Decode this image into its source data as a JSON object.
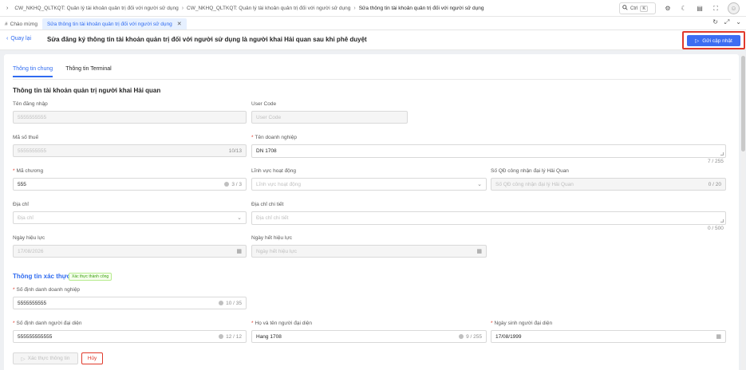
{
  "breadcrumb": [
    "CW_NKHQ_QLTKQT: Quản lý tài khoản quản trị đối với người sử dụng",
    "CW_NKHQ_QLTKQT: Quản lý tài khoản quản trị đối với người sử dụng",
    "Sửa thông tin tài khoản quản trị đối với người sử dụng"
  ],
  "search": {
    "kbd1": "Ctrl",
    "kbd2": "K"
  },
  "tabs": [
    {
      "label": "Chào mừng"
    },
    {
      "label": "Sửa thông tin tài khoản quản trị đối với người sử dụng"
    }
  ],
  "header": {
    "back_label": "Quay lại",
    "title": "Sửa đăng ký thông tin tài khoản quản trị đối với người sử dụng là người khai Hải quan sau khi phê duyệt",
    "submit_label": "Gửi cập nhật"
  },
  "form_tabs": [
    "Thông tin chung",
    "Thông tin Terminal"
  ],
  "section1": {
    "title": "Thông tin tài khoản quản trị người khai Hải quan",
    "username": {
      "label": "Tên đăng nhập",
      "value": "5555555555"
    },
    "user_code": {
      "label": "User Code",
      "placeholder": "User Code"
    },
    "tax_code": {
      "label": "Mã số thuế",
      "value": "5555555555",
      "count": "10/13"
    },
    "company_name": {
      "label": "Tên doanh nghiệp",
      "value": "DN 1708",
      "count": "7 / 255"
    },
    "agency_code": {
      "label": "Mã chương",
      "value": "555",
      "count": "3 / 3"
    },
    "field": {
      "label": "Lĩnh vực hoạt động",
      "placeholder": "Lĩnh vực hoạt động"
    },
    "decision_no": {
      "label": "Số QĐ công nhận đại lý Hải Quan",
      "placeholder": "Số QĐ công nhận đại lý Hải Quan",
      "count": "0 / 20"
    },
    "address": {
      "label": "Địa chỉ",
      "placeholder": "Địa chỉ"
    },
    "address_detail": {
      "label": "Địa chỉ chi tiết",
      "placeholder": "Địa chỉ chi tiết",
      "count": "0 / 500"
    },
    "effective_date": {
      "label": "Ngày hiệu lực",
      "value": "17/08/2026"
    },
    "expiry_date": {
      "label": "Ngày hết hiệu lực",
      "placeholder": "Ngày hết hiệu lực"
    }
  },
  "section2": {
    "title": "Thông tin xác thực",
    "badge": "Xác thực thành công",
    "company_id": {
      "label": "Số định danh doanh nghiệp",
      "value": "5555555555",
      "count": "10 / 35"
    },
    "rep_id": {
      "label": "Số định danh người đại diện",
      "value": "555555555555",
      "count": "12 / 12"
    },
    "rep_name": {
      "label": "Họ và tên người đại diện",
      "value": "Hang 1708",
      "count": "9 / 255"
    },
    "rep_dob": {
      "label": "Ngày sinh người đại diện",
      "value": "17/08/1999"
    }
  },
  "buttons": {
    "verify": "Xác thực thông tin",
    "cancel": "Hủy"
  },
  "colors": {
    "primary": "#2f6bf0",
    "danger": "#e0392b",
    "success": "#389e0d"
  }
}
